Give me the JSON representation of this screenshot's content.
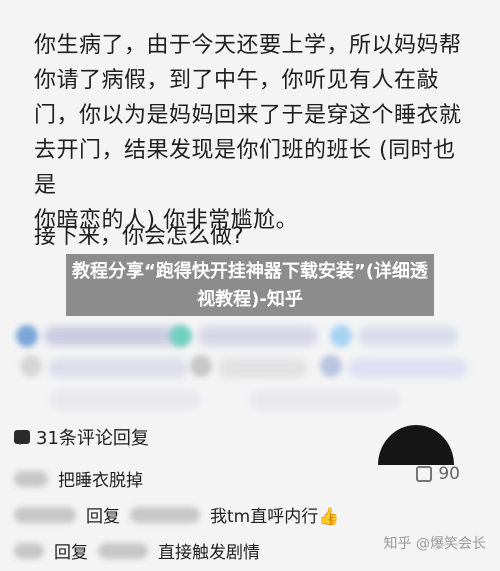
{
  "post": {
    "lines": [
      "你生病了，由于今天还要上学，所以妈妈帮",
      "你请了病假，到了中午，你听见有人在敲",
      "门，你以为是妈妈回来了于是穿这个睡衣就",
      "去开门，结果发现是你们班的班长 (同时也是",
      "你暗恋的人) 你非常尴尬。"
    ],
    "question": "接下来，你会怎么做?"
  },
  "overlay_title": "教程分享“跑得快开挂神器下载安装”(详细透视教程)-知乎",
  "comments": {
    "count_label": "31条评论回复",
    "items": [
      {
        "text": "把睡衣脱掉",
        "likes": "90"
      },
      {
        "prefix": "回复",
        "text": "我tm直呼内行👍"
      },
      {
        "prefix": "回复",
        "text": "直接触发剧情"
      }
    ]
  },
  "watermark": "知乎 @爆笑会长",
  "colors": {
    "overlay": "#6e6e6e",
    "background": "#f4f4f5",
    "text": "#1f1f1f"
  }
}
